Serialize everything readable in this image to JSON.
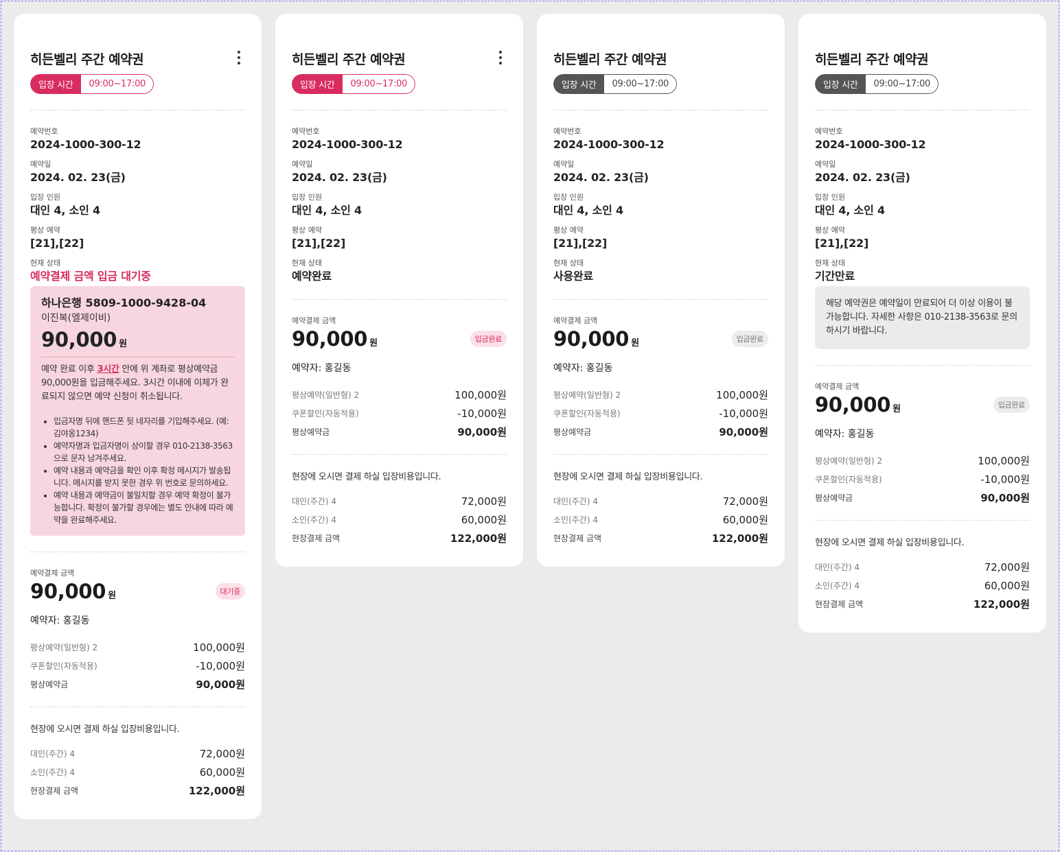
{
  "cards": [
    {
      "title": "히든벨리 주간 예약권",
      "time_tag": "입장 시간",
      "time_value": "09:00~17:00",
      "reservation_no_label": "예약번호",
      "reservation_no": "2024-1000-300-12",
      "reservation_date_label": "예약일",
      "reservation_date": "2024. 02. 23(금)",
      "people_label": "입장 인원",
      "people": "대인 4, 소인 4",
      "bed_label": "평상 예약",
      "bed": "[21],[22]",
      "status_label": "현재 상태",
      "status": "예약결제 금액 입금 대기중",
      "bank": {
        "account": "하나은행 5809-1000-9428-04",
        "holder": "이진복(엘제이비)",
        "amount": "90,000",
        "unit": "원",
        "note_before": "예약 완료 이후 ",
        "note_highlight": "3시간",
        "note_after": " 안에 위 계좌로 평상예약금 90,000원을 입금해주세요. 3시간 이내에 이체가 완료되지 않으면 예약 신청이 취소됩니다.",
        "bullets": [
          "입금자명 뒤에 핸드폰 뒷 네자리를 기입해주세요. (예:김야옹1234)",
          "예약자명과 입금자명이 상이할 경우 010-2138-3563으로 문자 남겨주세요.",
          "예약 내용과 예약금을 확인 이후 확정 메시지가 발송됩니다. 메시지를 받지 못한 경우 위 번호로 문의하세요.",
          "예약 내용과 예약금이 불일치할 경우 예약 확정이 불가능합니다. 확정이 불가할 경우에는 별도 안내에 따라 예약을 완료해주세요."
        ]
      },
      "pay_label": "예약결제 금액",
      "pay_amount": "90,000",
      "pay_unit": "원",
      "badge": "대기중",
      "booker": "예약자: 홍길동",
      "pay_lines": [
        {
          "k": "평상예약(일반형) 2",
          "v": "100,000원"
        },
        {
          "k": "쿠폰할인(자동적용)",
          "v": "-10,000원"
        },
        {
          "k": "평상예약금",
          "v": "90,000원"
        }
      ],
      "onsite_note": "현장에 오시면 결제 하실 입장비용입니다.",
      "onsite_lines": [
        {
          "k": "대인(주간) 4",
          "v": "72,000원"
        },
        {
          "k": "소인(주간) 4",
          "v": "60,000원"
        },
        {
          "k": "현장결제 금액",
          "v": "122,000원"
        }
      ]
    },
    {
      "title": "히든벨리 주간 예약권",
      "time_tag": "입장 시간",
      "time_value": "09:00~17:00",
      "reservation_no_label": "예약번호",
      "reservation_no": "2024-1000-300-12",
      "reservation_date_label": "예약일",
      "reservation_date": "2024. 02. 23(금)",
      "people_label": "입장 인원",
      "people": "대인 4, 소인 4",
      "bed_label": "평상 예약",
      "bed": "[21],[22]",
      "status_label": "현재 상태",
      "status": "예약완료",
      "pay_label": "예약결제 금액",
      "pay_amount": "90,000",
      "pay_unit": "원",
      "badge": "입금완료",
      "booker": "예약자: 홍길동",
      "pay_lines": [
        {
          "k": "평상예약(일반형) 2",
          "v": "100,000원"
        },
        {
          "k": "쿠폰할인(자동적용)",
          "v": "-10,000원"
        },
        {
          "k": "평상예약금",
          "v": "90,000원"
        }
      ],
      "onsite_note": "현장에 오시면 결제 하실 입장비용입니다.",
      "onsite_lines": [
        {
          "k": "대인(주간) 4",
          "v": "72,000원"
        },
        {
          "k": "소인(주간) 4",
          "v": "60,000원"
        },
        {
          "k": "현장결제 금액",
          "v": "122,000원"
        }
      ]
    },
    {
      "title": "히든벨리 주간 예약권",
      "time_tag": "입장 시간",
      "time_value": "09:00~17:00",
      "reservation_no_label": "예약번호",
      "reservation_no": "2024-1000-300-12",
      "reservation_date_label": "예약일",
      "reservation_date": "2024. 02. 23(금)",
      "people_label": "입장 인원",
      "people": "대인 4, 소인 4",
      "bed_label": "평상 예약",
      "bed": "[21],[22]",
      "status_label": "현재 상태",
      "status": "사용완료",
      "pay_label": "예약결제 금액",
      "pay_amount": "90,000",
      "pay_unit": "원",
      "badge": "입금완료",
      "booker": "예약자: 홍길동",
      "pay_lines": [
        {
          "k": "평상예약(일반형) 2",
          "v": "100,000원"
        },
        {
          "k": "쿠폰할인(자동적용)",
          "v": "-10,000원"
        },
        {
          "k": "평상예약금",
          "v": "90,000원"
        }
      ],
      "onsite_note": "현장에 오시면 결제 하실 입장비용입니다.",
      "onsite_lines": [
        {
          "k": "대인(주간) 4",
          "v": "72,000원"
        },
        {
          "k": "소인(주간) 4",
          "v": "60,000원"
        },
        {
          "k": "현장결제 금액",
          "v": "122,000원"
        }
      ]
    },
    {
      "title": "히든벨리 주간 예약권",
      "time_tag": "입장 시간",
      "time_value": "09:00~17:00",
      "reservation_no_label": "예약번호",
      "reservation_no": "2024-1000-300-12",
      "reservation_date_label": "예약일",
      "reservation_date": "2024. 02. 23(금)",
      "people_label": "입장 인원",
      "people": "대인 4, 소인 4",
      "bed_label": "평상 예약",
      "bed": "[21],[22]",
      "status_label": "현재 상태",
      "status": "기간만료",
      "expire_note": "해당 예약권은 예약일이 만료되어 더 이상 이용이 불가능합니다. 자세한 사항은 010-2138-3563로 문의하시기 바랍니다.",
      "pay_label": "예약결제 금액",
      "pay_amount": "90,000",
      "pay_unit": "원",
      "badge": "입금완료",
      "booker": "예약자: 홍길동",
      "pay_lines": [
        {
          "k": "평상예약(일반형) 2",
          "v": "100,000원"
        },
        {
          "k": "쿠폰할인(자동적용)",
          "v": "-10,000원"
        },
        {
          "k": "평상예약금",
          "v": "90,000원"
        }
      ],
      "onsite_note": "현장에 오시면 결제 하실 입장비용입니다.",
      "onsite_lines": [
        {
          "k": "대인(주간) 4",
          "v": "72,000원"
        },
        {
          "k": "소인(주간) 4",
          "v": "60,000원"
        },
        {
          "k": "현장결제 금액",
          "v": "122,000원"
        }
      ]
    }
  ],
  "colors": {
    "accent": "#d92c5e",
    "pending_box": "#f7d6df",
    "inactive_tag": "#555555",
    "background": "#ebebeb"
  }
}
